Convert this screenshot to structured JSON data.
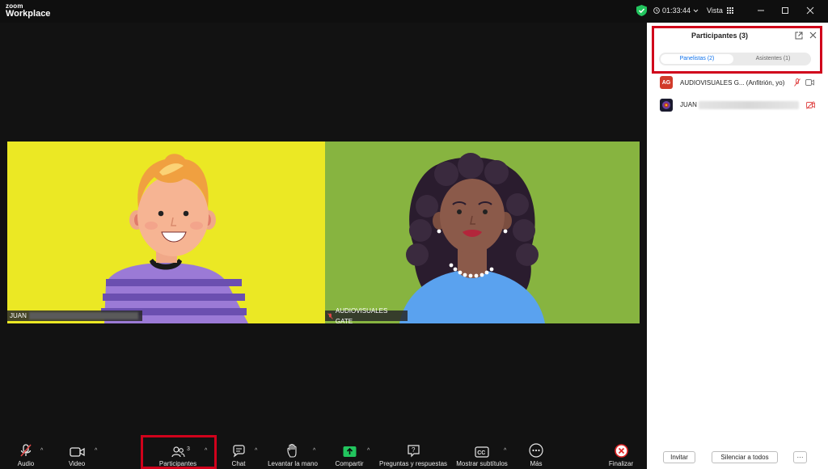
{
  "titlebar": {
    "logo_small": "zoom",
    "logo_big": "Workplace",
    "timer": "01:33:44",
    "view_label": "Vista"
  },
  "videos": [
    {
      "name": "JUAN",
      "bg": "#ebe824"
    },
    {
      "name": "AUDIOVISUALES GATE",
      "bg": "#87b440"
    }
  ],
  "toolbar": {
    "audio": "Audio",
    "video": "Video",
    "participants": "Participantes",
    "participants_count": "3",
    "chat": "Chat",
    "raise_hand": "Levantar la mano",
    "share": "Compartir",
    "qa": "Preguntas y respuestas",
    "captions": "Mostrar subtítulos",
    "more": "Más",
    "end": "Finalizar"
  },
  "panel": {
    "title": "Participantes (3)",
    "tab_panelists": "Panelistas (2)",
    "tab_attendees": "Asistentes (1)",
    "participants": [
      {
        "initials": "AG",
        "name": "AUDIOVISUALES G... (Anfitrión, yo)",
        "avatar_color": "#d13b2b"
      },
      {
        "initials": "",
        "name": "JUAN",
        "avatar_color": "#1a1a2e"
      }
    ],
    "invite_label": "Invitar",
    "mute_all_label": "Silenciar a todos",
    "more_label": "···"
  },
  "colors": {
    "highlight": "#d0021b",
    "accent": "#0e71eb",
    "share_green": "#22c55e",
    "end_red": "#e02828"
  },
  "icons": [
    "shield-check-icon",
    "clock-icon",
    "grid-icon",
    "minimize-icon",
    "maximize-icon",
    "close-icon",
    "mic-muted-icon",
    "video-camera-icon",
    "participants-icon",
    "chat-icon",
    "hand-icon",
    "share-screen-icon",
    "qa-icon",
    "cc-icon",
    "more-icon",
    "end-call-icon",
    "pop-out-icon"
  ]
}
